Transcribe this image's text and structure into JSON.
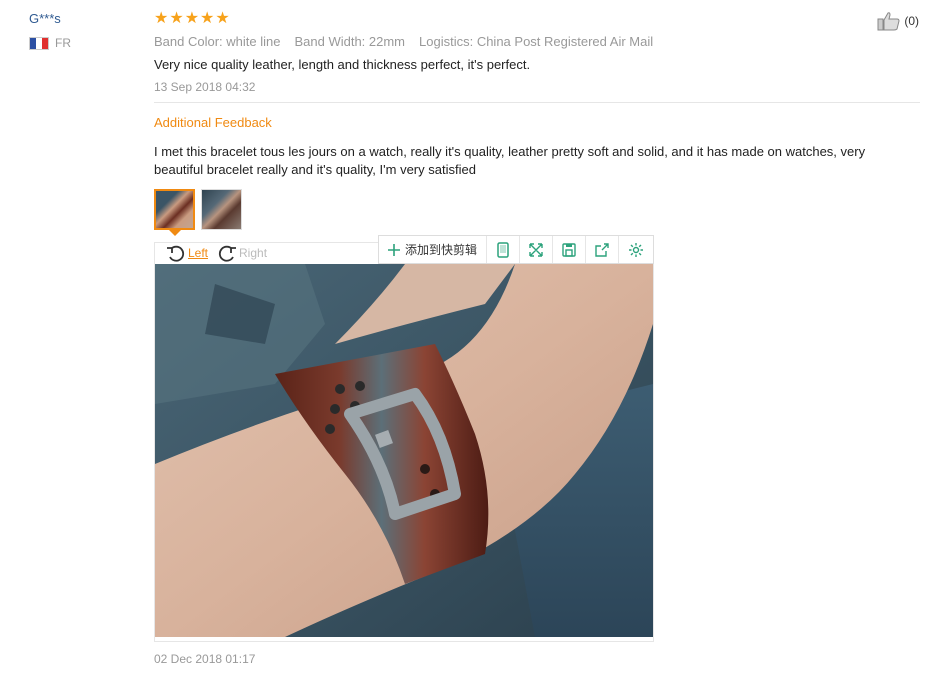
{
  "user": {
    "name": "G***s",
    "country_code": "FR"
  },
  "review": {
    "rating": 5,
    "attributes": [
      "Band Color: white line",
      "Band Width: 22mm",
      "Logistics: China Post Registered Air Mail"
    ],
    "text": "Very nice quality leather, length and thickness perfect, it's perfect.",
    "date": "13 Sep 2018 04:32",
    "likes": "(0)"
  },
  "additional_feedback": {
    "title": "Additional Feedback",
    "text": "I met this bracelet tous les jours on a watch, really it's quality, leather pretty soft and solid, and it has made on watches, very beautiful bracelet really and it's quality, I'm very satisfied",
    "date": "02 Dec 2018 01:17"
  },
  "viewer": {
    "rotate_left_label": "Left",
    "rotate_right_label": "Right",
    "toolbar_add_label": "添加到快剪辑"
  },
  "icons": {
    "star": "star-icon",
    "like": "thumbs-up-icon",
    "flag": "france-flag-icon",
    "rotate_left": "rotate-left-icon",
    "rotate_right": "rotate-right-icon",
    "add": "plus-icon",
    "tb1": "phone-icon",
    "tb2": "expand-icon",
    "tb3": "save-icon",
    "tb4": "share-icon",
    "tb5": "settings-icon"
  },
  "colors": {
    "accent": "#f08a12",
    "link": "#2f5a91",
    "muted": "#999999",
    "toolbar_icon": "#2ca27c"
  }
}
